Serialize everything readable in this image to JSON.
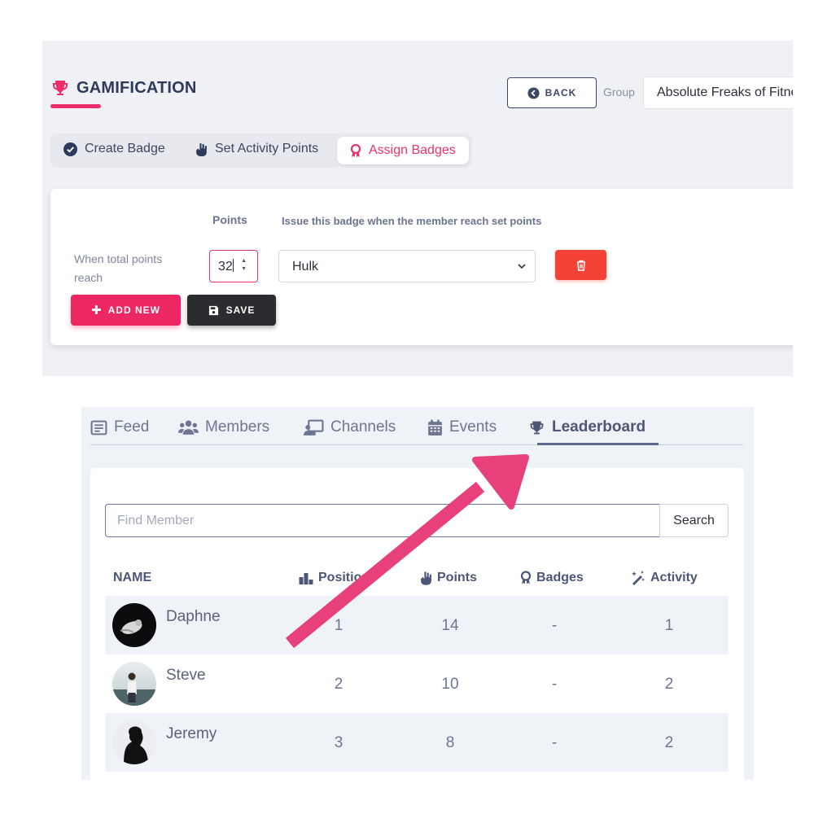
{
  "gamification": {
    "title": "GAMIFICATION",
    "back_label": "BACK",
    "group_label": "Group",
    "group_value": "Absolute Freaks of Fitness",
    "tabs": [
      {
        "label": "Create Badge",
        "icon": "check-circle-icon"
      },
      {
        "label": "Set Activity Points",
        "icon": "hand-point-icon"
      },
      {
        "label": "Assign Badges",
        "icon": "award-ribbon-icon",
        "active": true
      }
    ],
    "form": {
      "points_header": "Points",
      "issue_header": "Issue this badge when the member reach set points",
      "row_label": "When total points reach",
      "points_value": "32",
      "badge_value": "Hulk",
      "add_label": "ADD NEW",
      "save_label": "SAVE"
    }
  },
  "community": {
    "nav": [
      {
        "label": "Feed",
        "icon": "feed-icon"
      },
      {
        "label": "Members",
        "icon": "users-icon"
      },
      {
        "label": "Channels",
        "icon": "chalkboard-icon"
      },
      {
        "label": "Events",
        "icon": "calendar-icon"
      },
      {
        "label": "Leaderboard",
        "icon": "trophy-icon",
        "active": true
      }
    ],
    "search": {
      "placeholder": "Find Member",
      "button_label": "Search"
    },
    "columns": {
      "name": "NAME",
      "position": "Position",
      "points": "Points",
      "badges": "Badges",
      "activity": "Activity"
    },
    "rows": [
      {
        "name": "Daphne",
        "position": "1",
        "points": "14",
        "badges": "-",
        "activity": "1"
      },
      {
        "name": "Steve",
        "position": "2",
        "points": "10",
        "badges": "-",
        "activity": "2"
      },
      {
        "name": "Jeremy",
        "position": "3",
        "points": "8",
        "badges": "-",
        "activity": "2"
      }
    ]
  },
  "colors": {
    "accent_pink": "#ec2762",
    "navy": "#2e3a5c",
    "delete_red": "#f44336",
    "annotation_arrow": "#e8407a"
  }
}
